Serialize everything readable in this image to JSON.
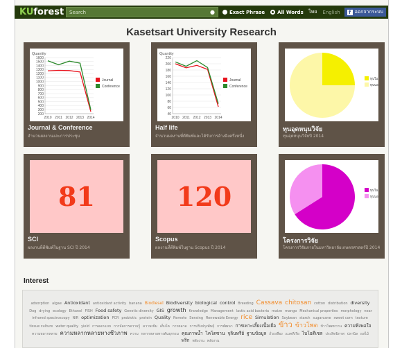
{
  "header": {
    "logo_ku": "KU",
    "logo_forest": "forest",
    "search_placeholder": "Search",
    "search_icon": "magnifier-icon",
    "radio_exact": "Exact Phrase",
    "radio_all": "All Words",
    "lang_th": "ไทย",
    "lang_en": "English",
    "fb_label": "ออกจากระบบ"
  },
  "page_title": "Kasetsart University Research",
  "cards": [
    {
      "title": "Journal & Conference",
      "sub": "จำนวนผลงานและการประชุม",
      "chart_label": "Quantity",
      "legend": [
        "Journal",
        "Conference"
      ]
    },
    {
      "title": "Half life",
      "sub": "จำนวนผลงานที่ตีพิมพ์และได้รับการอ้างอิงครึ่งหนึ่ง",
      "chart_label": "Quantity",
      "legend": [
        "Journal",
        "Conference"
      ]
    },
    {
      "title": "ทุนอุดหนุนวิจัย",
      "sub": "ทุนอุดหนุนวิจัยปี 2014",
      "legend": [
        "ทุนใน",
        "ทุนนอก"
      ]
    },
    {
      "title": "SCI",
      "sub": "ผลงานที่ตีพิมพ์ในฐาน SCI ปี 2014",
      "value": "81"
    },
    {
      "title": "Scopus",
      "sub": "ผลงานที่ตีพิมพ์ในฐาน Scopus ปี 2014",
      "value": "120"
    },
    {
      "title": "โครงการวิจัย",
      "sub": "โครงการวิจัยภายในมหาวิทยาลัยเกษตรศาสตร์ปี 2014",
      "legend": [
        "ทุนใน",
        "ทุนนอก"
      ]
    }
  ],
  "chart_data": [
    {
      "type": "line",
      "ylabel": "Quantity",
      "x": [
        "2010",
        "2011",
        "2012",
        "2013",
        "2014"
      ],
      "ylim": [
        200,
        1600
      ],
      "yticks": [
        200,
        300,
        400,
        500,
        600,
        700,
        800,
        900,
        1000,
        1100,
        1200,
        1300,
        1400,
        1500,
        1600
      ],
      "series": [
        {
          "name": "Journal",
          "color": "#e8141e",
          "values": [
            1270,
            1280,
            1275,
            1240,
            250
          ]
        },
        {
          "name": "Conference",
          "color": "#2d8a2d",
          "values": [
            1520,
            1420,
            1510,
            1460,
            300
          ]
        }
      ]
    },
    {
      "type": "line",
      "ylabel": "Quantity",
      "x": [
        "2010",
        "2011",
        "2012",
        "2013",
        "2014"
      ],
      "ylim": [
        40,
        220
      ],
      "yticks": [
        40,
        60,
        80,
        100,
        120,
        140,
        160,
        180,
        200,
        220
      ],
      "series": [
        {
          "name": "Journal",
          "color": "#e8141e",
          "values": [
            200,
            187,
            195,
            182,
            62
          ]
        },
        {
          "name": "Conference",
          "color": "#2d8a2d",
          "values": [
            206,
            192,
            210,
            188,
            72
          ]
        }
      ]
    },
    {
      "type": "pie",
      "labels": [
        "ทุนใน",
        "ทุนนอก"
      ],
      "colors": [
        "#f5f000",
        "#fdf7a8"
      ],
      "values": [
        25,
        75
      ]
    },
    {
      "type": "pie",
      "labels": [
        "ทุนใน",
        "ทุนนอก"
      ],
      "colors": [
        "#d400c8",
        "#f590f0"
      ],
      "values": [
        66,
        34
      ]
    }
  ],
  "interest": {
    "heading": "Interest",
    "tags": [
      {
        "t": "adsorption",
        "c": "t-sm"
      },
      {
        "t": "algae",
        "c": "t-sm"
      },
      {
        "t": "Antioxidant",
        "c": "t-md"
      },
      {
        "t": "antioxidant activity",
        "c": "t-sm"
      },
      {
        "t": "banana",
        "c": "t-sm"
      },
      {
        "t": "Biodiesel",
        "c": "t-or"
      },
      {
        "t": "Biodiversity",
        "c": "t-md"
      },
      {
        "t": "biological",
        "c": "t-md"
      },
      {
        "t": "control",
        "c": "t-md"
      },
      {
        "t": "Breeding",
        "c": "t-sm"
      },
      {
        "t": "Cassava",
        "c": "t-orl"
      },
      {
        "t": "chitosan",
        "c": "t-orl"
      },
      {
        "t": "cotton",
        "c": "t-sm"
      },
      {
        "t": "distribution",
        "c": "t-sm"
      },
      {
        "t": "diversity",
        "c": "t-md"
      },
      {
        "t": "Dog",
        "c": "t-sm"
      },
      {
        "t": "drying",
        "c": "t-sm"
      },
      {
        "t": "ecology",
        "c": "t-sm"
      },
      {
        "t": "Ethanol",
        "c": "t-sm"
      },
      {
        "t": "FISH",
        "c": "t-sm"
      },
      {
        "t": "Food safety",
        "c": "t-md"
      },
      {
        "t": "Genetic diversity",
        "c": "t-sm"
      },
      {
        "t": "GIS",
        "c": "t-md"
      },
      {
        "t": "growth",
        "c": "t-lg"
      },
      {
        "t": "Knowledge",
        "c": "t-sm"
      },
      {
        "t": "Management",
        "c": "t-sm"
      },
      {
        "t": "lactic acid bacteria",
        "c": "t-sm"
      },
      {
        "t": "maize",
        "c": "t-sm"
      },
      {
        "t": "mango",
        "c": "t-sm"
      },
      {
        "t": "Mechanical properties",
        "c": "t-sm"
      },
      {
        "t": "morphology",
        "c": "t-sm"
      },
      {
        "t": "near infrared spectroscopy",
        "c": "t-sm"
      },
      {
        "t": "NIR",
        "c": "t-sm"
      },
      {
        "t": "optimization",
        "c": "t-md"
      },
      {
        "t": "PCR",
        "c": "t-sm"
      },
      {
        "t": "probiotic",
        "c": "t-sm"
      },
      {
        "t": "protein",
        "c": "t-sm"
      },
      {
        "t": "Quality",
        "c": "t-md"
      },
      {
        "t": "Remote",
        "c": "t-sm"
      },
      {
        "t": "Sensing",
        "c": "t-sm"
      },
      {
        "t": "Renewable Energy",
        "c": "t-sm"
      },
      {
        "t": "rice",
        "c": "t-orl"
      },
      {
        "t": "Simulation",
        "c": "t-md"
      },
      {
        "t": "Soybean",
        "c": "t-sm"
      },
      {
        "t": "starch",
        "c": "t-sm"
      },
      {
        "t": "sugarcane",
        "c": "t-sm"
      },
      {
        "t": "sweet corn",
        "c": "t-sm"
      },
      {
        "t": "texture",
        "c": "t-sm"
      },
      {
        "t": "tissue culture",
        "c": "t-sm"
      },
      {
        "t": "water quality",
        "c": "t-sm"
      },
      {
        "t": "yield",
        "c": "t-sm"
      },
      {
        "t": "การออกแบบ",
        "c": "t-sm"
      },
      {
        "t": "การจัดการความรู้",
        "c": "t-sm"
      },
      {
        "t": "ความเข้ม",
        "c": "t-sm"
      },
      {
        "t": "เต็บโต",
        "c": "t-sm"
      },
      {
        "t": "การตลาด",
        "c": "t-sm"
      },
      {
        "t": "การปรับปรุงพันธุ์",
        "c": "t-sm"
      },
      {
        "t": "การพัฒนา",
        "c": "t-sm"
      },
      {
        "t": "การเพาะเลี้ยงเนื้อเยื่อ",
        "c": "t-md"
      },
      {
        "t": "ข้าว",
        "c": "t-orx"
      },
      {
        "t": "ข้าวโพด",
        "c": "t-orl"
      },
      {
        "t": "ข้าวโพดหวาน",
        "c": "t-sm"
      },
      {
        "t": "ความพึงพอใจ",
        "c": "t-md"
      },
      {
        "t": "ความหลากหลาย",
        "c": "t-sm"
      },
      {
        "t": "ความหลากหลายทางชีวภาพ",
        "c": "t-lg"
      },
      {
        "t": "ความ",
        "c": "t-sm"
      },
      {
        "t": "หลากหลายทางพันธุกรรม",
        "c": "t-sm"
      },
      {
        "t": "คุณภาพน้ำ",
        "c": "t-md"
      },
      {
        "t": "ไคโตซาน",
        "c": "t-md"
      },
      {
        "t": "จุลินทรีย์",
        "c": "t-md"
      },
      {
        "t": "ฐานข้อมูล",
        "c": "t-md"
      },
      {
        "t": "ถั่วเหลือง",
        "c": "t-sm"
      },
      {
        "t": "แบคทีเรีย",
        "c": "t-sm"
      },
      {
        "t": "ไบโอดีเซล",
        "c": "t-md"
      },
      {
        "t": "ประสิทธิภาพ",
        "c": "t-sm"
      },
      {
        "t": "ปลานิล",
        "c": "t-sm"
      },
      {
        "t": "ผลไม้",
        "c": "t-sm"
      },
      {
        "t": "พริก",
        "c": "t-md"
      },
      {
        "t": "พลังงาน",
        "c": "t-sm"
      },
      {
        "t": "พลังงาน",
        "c": "t-sm"
      }
    ]
  }
}
